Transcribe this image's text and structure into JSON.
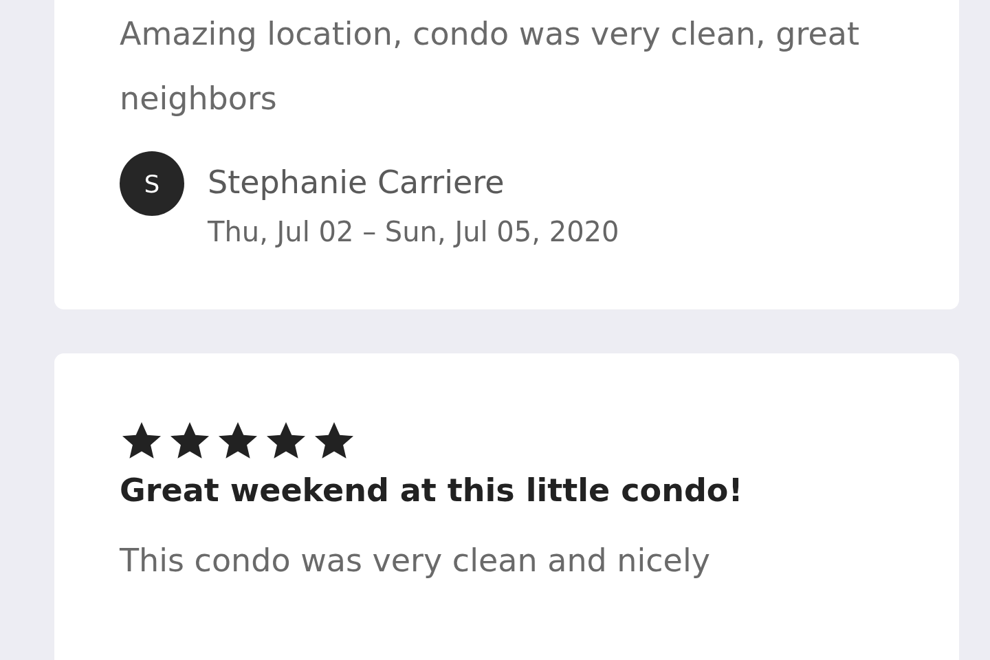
{
  "reviews": [
    {
      "body": "Amazing location, condo was very clean, great neighbors",
      "reviewer": {
        "initial": "S",
        "name": "Stephanie Carriere"
      },
      "dates": "Thu, Jul 02 – Sun, Jul 05, 2020"
    },
    {
      "stars": 5,
      "title": "Great weekend at this little condo!",
      "body": "This condo was very clean and nicely"
    }
  ]
}
